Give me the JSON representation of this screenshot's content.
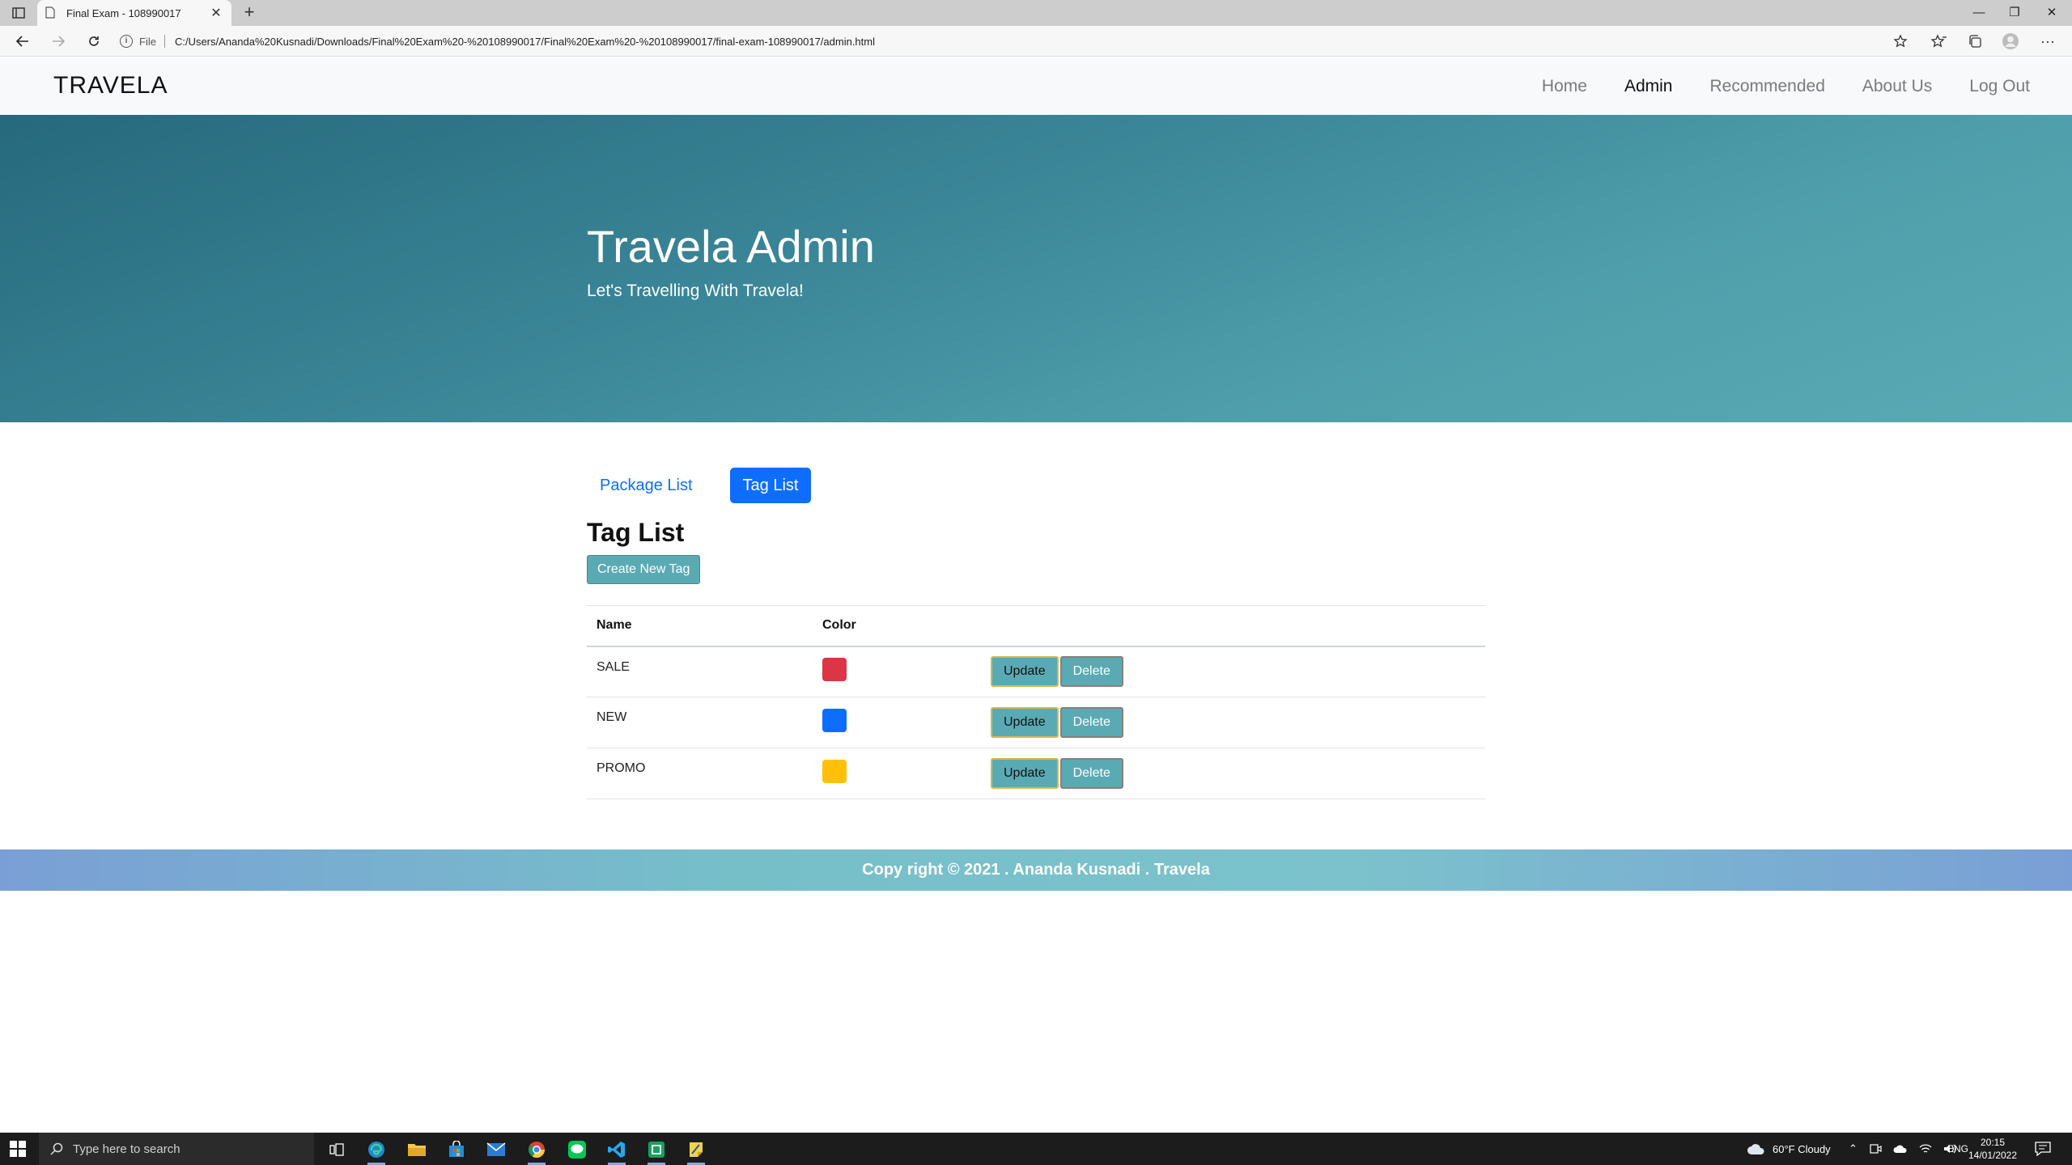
{
  "browser": {
    "tab_title": "Final Exam - 108990017",
    "new_tab": "+",
    "address_scheme": "File",
    "url": "C:/Users/Ananda%20Kusnadi/Downloads/Final%20Exam%20-%20108990017/Final%20Exam%20-%20108990017/final-exam-108990017/admin.html"
  },
  "site": {
    "brand": "TRAVELA",
    "nav": [
      {
        "label": "Home"
      },
      {
        "label": "Admin"
      },
      {
        "label": "Recommended"
      },
      {
        "label": "About Us"
      },
      {
        "label": "Log Out"
      }
    ],
    "active_nav": "Admin",
    "hero": {
      "title": "Travela Admin",
      "subtitle": "Let's Travelling With Travela!"
    }
  },
  "content": {
    "tabs": [
      {
        "label": "Package List"
      },
      {
        "label": "Tag List"
      }
    ],
    "active_tab": "Tag List",
    "section_title": "Tag List",
    "create_button": "Create New Tag",
    "table": {
      "headers": [
        "Name",
        "Color",
        ""
      ],
      "rows": [
        {
          "name": "SALE",
          "color": "#dc3545",
          "update": "Update",
          "delete": "Delete"
        },
        {
          "name": "NEW",
          "color": "#0d6efd",
          "update": "Update",
          "delete": "Delete"
        },
        {
          "name": "PROMO",
          "color": "#ffc107",
          "update": "Update",
          "delete": "Delete"
        }
      ]
    }
  },
  "footer": {
    "text": "Copy right © 2021 . Ananda Kusnadi . Travela"
  },
  "taskbar": {
    "search_placeholder": "Type here to search",
    "weather": "60°F  Cloudy",
    "language": "ENG",
    "time": "20:15",
    "date": "14/01/2022"
  },
  "colors": {
    "hero_start": "#26697d",
    "hero_end": "#5aaab4",
    "primary": "#0d6efd",
    "teal_button": "#5aaab4"
  }
}
